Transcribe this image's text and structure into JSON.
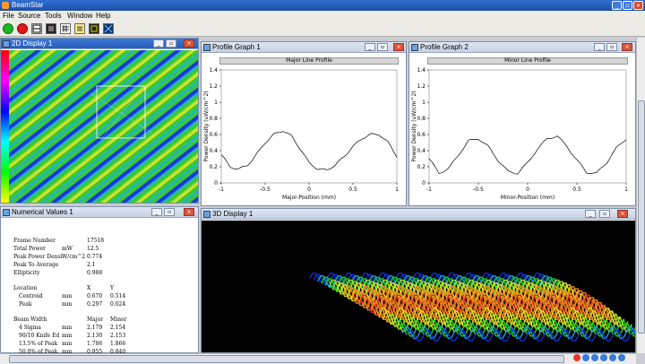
{
  "app": {
    "title": "BeamStar"
  },
  "menu": [
    "File",
    "Source",
    "Tools",
    "Window",
    "Help"
  ],
  "toolbar": [
    "run-icon",
    "stop-icon",
    "frame-icon",
    "capture-icon",
    "grid-icon",
    "notes-icon",
    "display-icon",
    "crosshair-icon"
  ],
  "windows": {
    "display2d": {
      "title": "2D Display 1"
    },
    "profile1": {
      "title": "Profile Graph 1",
      "plot_title": "Major Line Profile",
      "xlabel": "Major-Position (mm)",
      "ylabel": "Power Density (uW/cm^2)"
    },
    "profile2": {
      "title": "Profile Graph 2",
      "plot_title": "Minor Line Profile",
      "xlabel": "Minor-Position (mm)",
      "ylabel": "Power Density (uW/cm^2)"
    },
    "numerical": {
      "title": "Numerical Values 1"
    },
    "display3d": {
      "title": "3D Display 1"
    }
  },
  "numerical": {
    "rows": [
      {
        "label": "Frame Number",
        "unit": "",
        "v1": "17518",
        "v2": ""
      },
      {
        "label": "Total Power",
        "unit": "mW",
        "v1": "12.5",
        "v2": ""
      },
      {
        "label": "Peak Power Densi",
        "unit": "W/cm^2",
        "v1": "0.774",
        "v2": ""
      },
      {
        "label": "Peak To Average",
        "unit": "",
        "v1": "2.1",
        "v2": ""
      },
      {
        "label": "Ellipticity",
        "unit": "",
        "v1": "0.988",
        "v2": ""
      },
      {
        "label": "Location",
        "unit": "",
        "v1": "X",
        "v2": "Y"
      },
      {
        "label": "Centroid",
        "unit": "mm",
        "v1": "0.670",
        "v2": "0.514",
        "indent": true
      },
      {
        "label": "Peak",
        "unit": "mm",
        "v1": "0.297",
        "v2": "0.024",
        "indent": true
      },
      {
        "label": "Beam Width",
        "unit": "",
        "v1": "Major",
        "v2": "Minor"
      },
      {
        "label": "4 Sigma",
        "unit": "mm",
        "v1": "2.179",
        "v2": "2.154",
        "indent": true
      },
      {
        "label": "90/10 Knife Ed",
        "unit": "mm",
        "v1": "2.130",
        "v2": "2.153",
        "indent": true
      },
      {
        "label": "13.5% of Peak",
        "unit": "mm",
        "v1": "1.786",
        "v2": "1.866",
        "indent": true
      },
      {
        "label": "50.0% of Peak",
        "unit": "mm",
        "v1": "0.955",
        "v2": "0.840",
        "indent": true
      }
    ]
  },
  "chart_data": [
    {
      "type": "line",
      "title": "Major Line Profile",
      "xlabel": "Major-Position (mm)",
      "ylabel": "Power Density (uW/cm^2)",
      "xlim": [
        -1,
        1
      ],
      "ylim": [
        0,
        1.4
      ],
      "xticks": [
        "-1",
        "-0.5",
        "0",
        "0.5",
        "1"
      ],
      "yticks": [
        "0",
        "0.2",
        "0.4",
        "0.6",
        "0.8",
        "1",
        "1.2",
        "1.4"
      ],
      "series": [
        {
          "x": [
            -1,
            -0.9,
            -0.8,
            -0.7,
            -0.6,
            -0.5,
            -0.4,
            -0.3,
            -0.2,
            -0.1,
            0,
            0.1,
            0.2,
            0.3,
            0.4,
            0.5,
            0.6,
            0.7,
            0.8,
            0.9,
            1
          ],
          "values": [
            0.35,
            0.2,
            0.17,
            0.22,
            0.35,
            0.5,
            0.6,
            0.65,
            0.58,
            0.42,
            0.25,
            0.17,
            0.16,
            0.22,
            0.33,
            0.45,
            0.55,
            0.6,
            0.6,
            0.5,
            0.33
          ]
        }
      ]
    },
    {
      "type": "line",
      "title": "Minor Line Profile",
      "xlabel": "Minor-Position (mm)",
      "ylabel": "Power Density (uW/cm^2)",
      "xlim": [
        -1,
        1
      ],
      "ylim": [
        0,
        1.4
      ],
      "xticks": [
        "-1",
        "-0.5",
        "0",
        "0.5",
        "1"
      ],
      "yticks": [
        "0",
        "0.2",
        "0.4",
        "0.6",
        "0.8",
        "1",
        "1.2",
        "1.4"
      ],
      "series": [
        {
          "x": [
            -1,
            -0.9,
            -0.8,
            -0.7,
            -0.6,
            -0.5,
            -0.4,
            -0.3,
            -0.2,
            -0.1,
            0,
            0.1,
            0.2,
            0.3,
            0.4,
            0.5,
            0.6,
            0.7,
            0.8,
            0.9,
            1
          ],
          "values": [
            0.3,
            0.12,
            0.18,
            0.35,
            0.52,
            0.55,
            0.45,
            0.28,
            0.14,
            0.12,
            0.25,
            0.42,
            0.55,
            0.58,
            0.45,
            0.28,
            0.13,
            0.12,
            0.25,
            0.43,
            0.55
          ]
        }
      ]
    }
  ]
}
